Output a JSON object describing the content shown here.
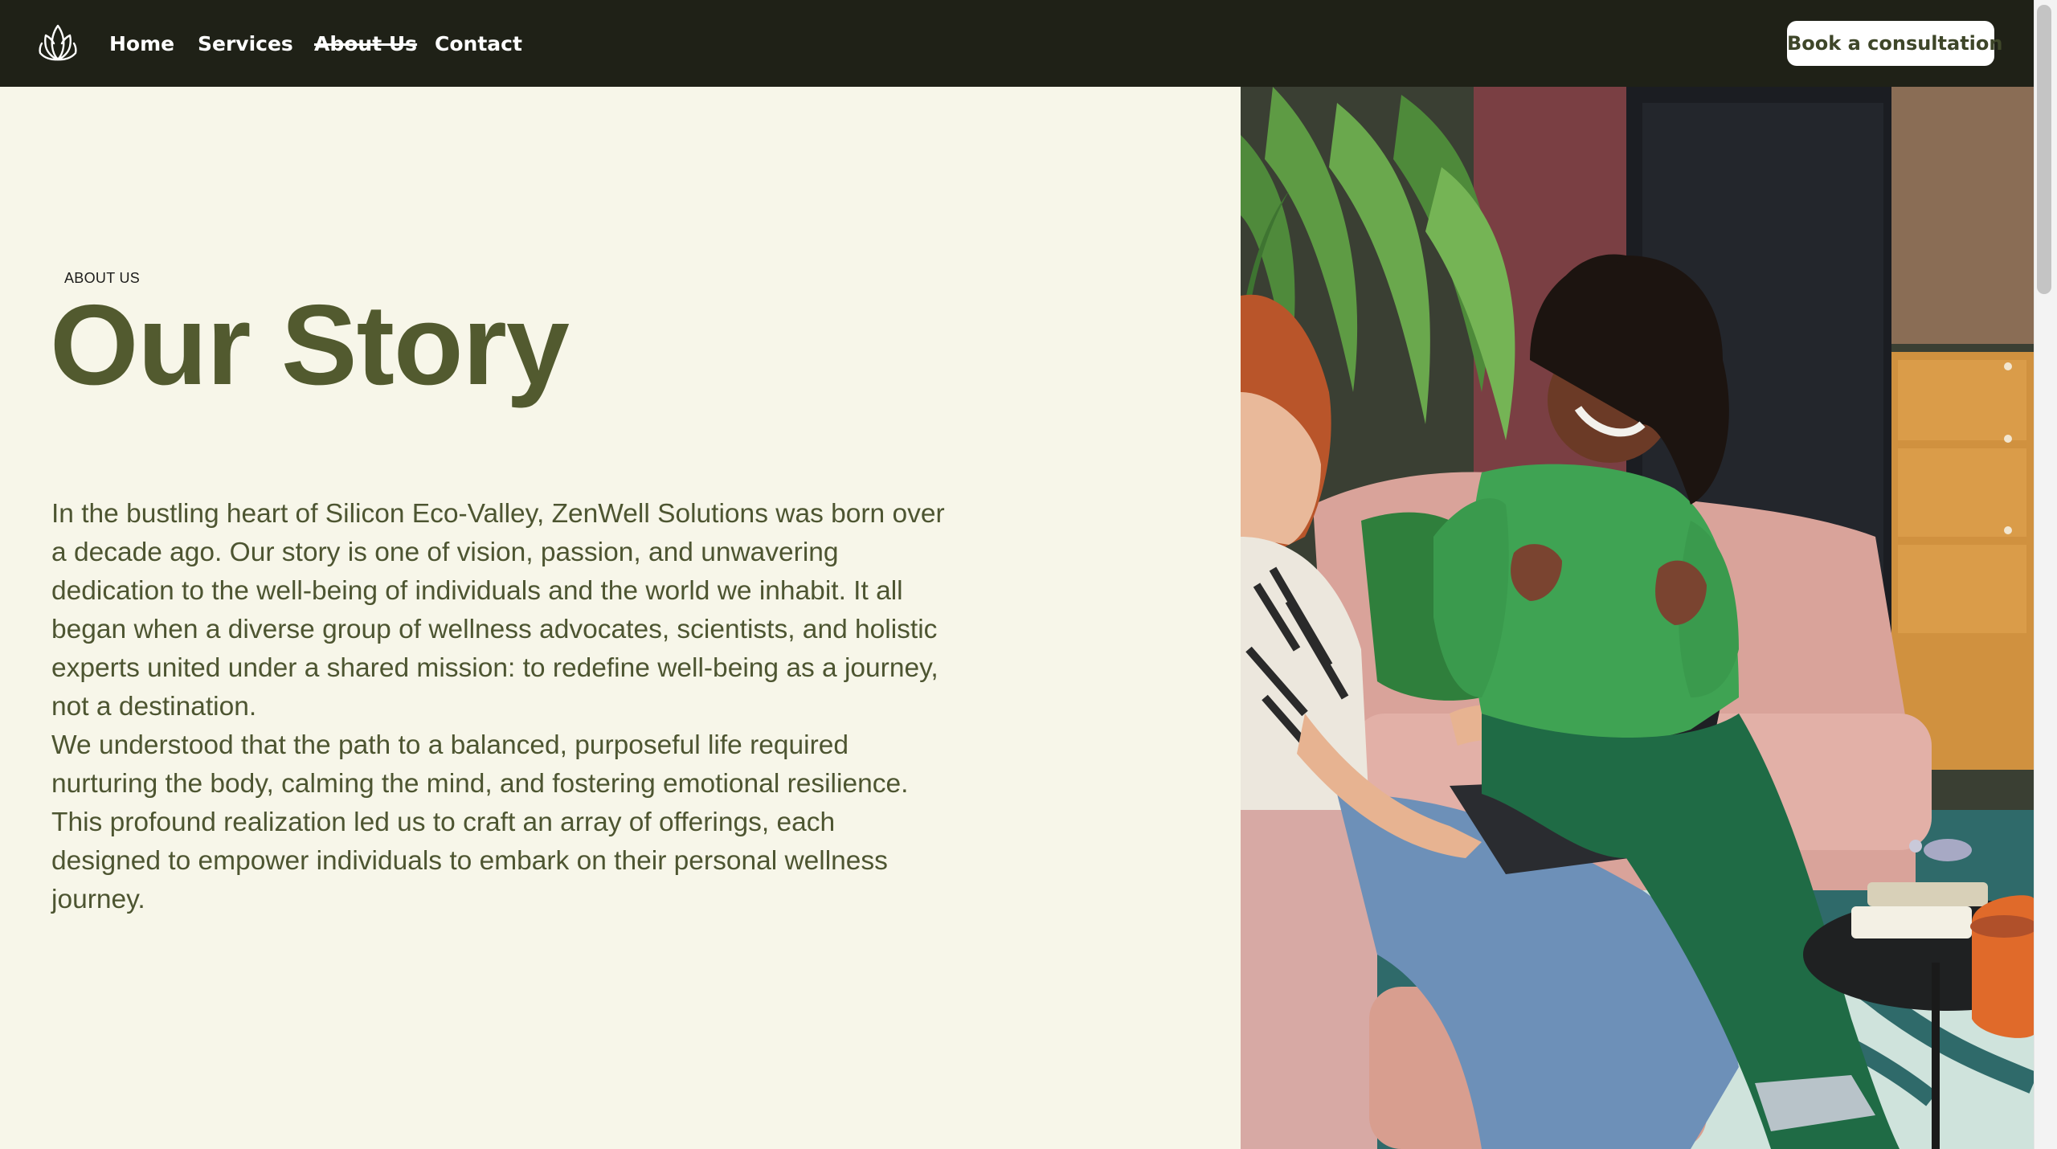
{
  "nav": {
    "logo_icon": "lotus-icon",
    "links": [
      {
        "label": "Home"
      },
      {
        "label": "Services"
      },
      {
        "label": "About Us",
        "state": "current"
      },
      {
        "label": "Contact"
      }
    ],
    "cta_label": "Book a consultation"
  },
  "hero": {
    "eyebrow": "ABOUT US",
    "title": "Our Story",
    "paragraphs": [
      "In the bustling heart of Silicon Eco-Valley, ZenWell Solutions was born over a decade ago. Our story is one of vision, passion, and unwavering dedication to the well-being of individuals and the world we inhabit. It all began when a diverse group of wellness advocates, scientists, and holistic experts united under a shared mission: to redefine well-being as a journey, not a destination.",
      "We understood that the path to a balanced, purposeful life required nurturing the body, calming the mind, and fostering emotional resilience. This profound realization led us to craft an array of offerings, each designed to empower individuals to embark on their personal wellness journey."
    ]
  },
  "colors": {
    "nav_background": "#1f2117",
    "page_background": "#f7f6e9",
    "title": "#525a2f",
    "body_text": "#4d5531",
    "cta_background": "#ffffff",
    "cta_text": "#3e4629"
  }
}
